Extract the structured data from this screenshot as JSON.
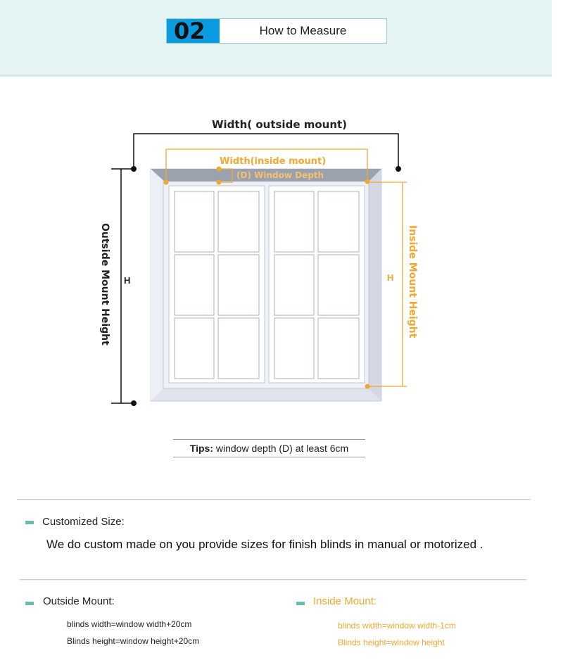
{
  "header": {
    "number": "02",
    "title": "How to Measure"
  },
  "diagram": {
    "width_outside": "Width( outside mount)",
    "width_inside": "Width(inside mount)",
    "depth": "(D) Window Depth",
    "outside_height": "Outside Mount  Height",
    "inside_height": "Inside Mount  Height",
    "h_left": "H",
    "h_right": "H",
    "orange": "#f0a830"
  },
  "tips": {
    "label": "Tips:",
    "text": " window depth (D) at least 6cm"
  },
  "customized": {
    "heading": "Customized Size:",
    "text": "We do custom made on you provide sizes for finish blinds in manual or motorized ."
  },
  "outside": {
    "heading": "Outside Mount:",
    "lines": [
      "blinds width=window width+20cm",
      "Blinds height=window height+20cm"
    ]
  },
  "inside": {
    "heading": "Inside Mount:",
    "lines": [
      "blinds width=window width-1cm",
      "Blinds height=window height"
    ]
  }
}
